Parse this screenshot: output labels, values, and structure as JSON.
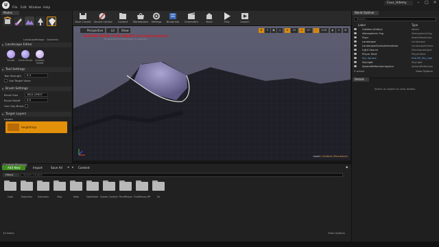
{
  "menu": {
    "items": [
      "File",
      "Edit",
      "Window",
      "Help"
    ],
    "project_tab": "Cour_Udemy"
  },
  "modes": {
    "tab": "Modes",
    "mode_buttons": [
      "Place",
      "Paint",
      "Landscape",
      "Foliage",
      "Geometry"
    ],
    "mode_labels": [
      "Landscape",
      "Foliage",
      "Geometry"
    ],
    "editor_header": "Landscape Editor",
    "tools": [
      {
        "label": "Sculpt",
        "color": "#9a7fd6"
      },
      {
        "label": "Circle Brush",
        "color": "#8a79cf"
      },
      {
        "label": "Smooth Falloff",
        "color": "#b39de0"
      }
    ],
    "tool_settings": {
      "header": "Tool Settings",
      "strength_label": "Tool Strength",
      "strength_value": "0.3",
      "use_target_label": "Use Target Value"
    },
    "brush_settings": {
      "header": "Brush Settings",
      "size_label": "Brush Size",
      "size_value": "1811.23917",
      "falloff_label": "Brush Falloff",
      "falloff_value": "0.5",
      "clay_label": "Use Clay Brush"
    },
    "target_layers": {
      "header": "Target Layers",
      "layers_label": "Layers",
      "layer_name": "Heightmap"
    }
  },
  "toolbar": {
    "buttons": [
      "Save Current",
      "Source Control",
      "Content",
      "Marketplace",
      "Settings",
      "Blueprints",
      "Cinematics",
      "Build",
      "Play",
      "Launch"
    ]
  },
  "viewport": {
    "perspective": "Perspective",
    "lit": "Lit",
    "show": "Show",
    "warning": "LIGHTING NEEDS TO BE REBUILT (35 unbuilt objects)",
    "warning_sub": "'DisableAllScreenMessages' to suppress",
    "grid_snap": "10",
    "rot_snap": "10°",
    "scale_snap": "0.25",
    "cam_speed": "4",
    "level_label": "Level:",
    "level_name": "Untitled (Persistent)"
  },
  "content_browser": {
    "tab": "Content Browser",
    "add_new": "Add New",
    "import": "Import",
    "save_all": "Save All",
    "path": "Content",
    "filters": "Filters",
    "search_placeholder": "Search Content",
    "folders": [
      "Code",
      "Distortion",
      "Geometry",
      "Map",
      "Mats",
      "NewFolder",
      "Starter Content",
      "ThirdPerson",
      "ThirdPerson BP",
      "Ue"
    ],
    "item_count": "15 items",
    "view_options": "View Options"
  },
  "outliner": {
    "tab": "World Outliner",
    "search_placeholder": "Search...",
    "col_label": "Label",
    "col_type": "Type",
    "rows": [
      {
        "label": "Untitled (Editor)",
        "type": "World",
        "state": "normal"
      },
      {
        "label": "Atmospheric Fog",
        "type": "AtmosphericFog",
        "state": "normal"
      },
      {
        "label": "Floor",
        "type": "StaticMeshActor",
        "state": "normal"
      },
      {
        "label": "Landscape",
        "type": "Landscape",
        "state": "normal"
      },
      {
        "label": "LandscapeGizmoActiveActor",
        "type": "LandscapeGizmo",
        "state": "normal"
      },
      {
        "label": "Light Source",
        "type": "DirectionalLight",
        "state": "normal"
      },
      {
        "label": "Player Start",
        "type": "PlayerStart",
        "state": "normal"
      },
      {
        "label": "Sky Sphere",
        "type": "Edit BP_Sky_Sph",
        "state": "hl"
      },
      {
        "label": "SkyLight",
        "type": "SkyLight",
        "state": "normal"
      },
      {
        "label": "SphereReflectionCapture",
        "type": "SphereReflection",
        "state": "normal"
      }
    ],
    "actor_count": "9 actors",
    "view_options": "View Options"
  },
  "details": {
    "tab": "Details",
    "hint": "Select an object to view details."
  },
  "colors": {
    "accent": "#d98a0a",
    "add_new": "#3f8b21",
    "warning": "#e0161b",
    "terrain_highlight": "#8f88c8"
  }
}
